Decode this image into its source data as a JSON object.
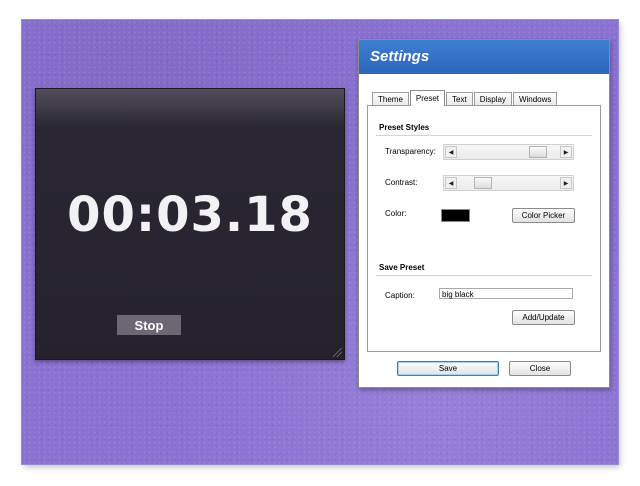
{
  "stopwatch": {
    "time": "00:03.18",
    "stop_label": "Stop"
  },
  "settings": {
    "title": "Settings",
    "tabs": [
      {
        "label": "Theme",
        "active": false
      },
      {
        "label": "Preset",
        "active": true
      },
      {
        "label": "Text",
        "active": false
      },
      {
        "label": "Display",
        "active": false
      },
      {
        "label": "Windows",
        "active": false
      }
    ],
    "preset_styles": {
      "heading": "Preset Styles",
      "transparency_label": "Transparency:",
      "transparency_value": 0.85,
      "contrast_label": "Contrast:",
      "contrast_value": 0.2,
      "color_label": "Color:",
      "color_value": "#000000",
      "color_picker_label": "Color Picker"
    },
    "save_preset": {
      "heading": "Save Preset",
      "caption_label": "Caption:",
      "caption_value": "big black",
      "add_update_label": "Add/Update"
    },
    "save_label": "Save",
    "close_label": "Close"
  },
  "colors": {
    "background": "#8a72d3",
    "stopwatch_bg": "#25222d",
    "titlebar": "#3f7fd0"
  },
  "icons": {
    "slider_left": "arrow-left-icon",
    "slider_right": "arrow-right-icon",
    "resize_grip": "resize-grip-icon"
  }
}
